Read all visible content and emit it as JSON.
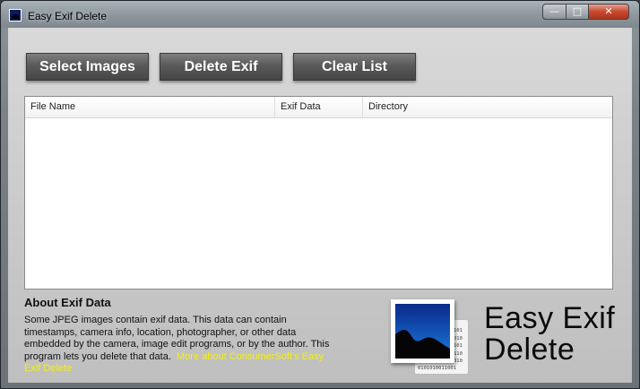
{
  "window": {
    "title": "Easy Exif Delete",
    "controls": {
      "minimize": "—",
      "maximize": "□",
      "close": "✕"
    }
  },
  "toolbar": {
    "select_images": "Select Images",
    "delete_exif": "Delete Exif",
    "clear_list": "Clear List"
  },
  "file_list": {
    "columns": [
      "File Name",
      "Exif Data",
      "Directory"
    ],
    "rows": []
  },
  "about": {
    "title": "About Exif Data",
    "text": "Some JPEG images contain exif data. This data can contain timestamps, camera info, location, photographer, or other data embedded by the camera, image edit programs, or by the author. This program lets you delete that data.",
    "link": "More about ConsumerSoft's Easy Exif Delete"
  },
  "branding": {
    "line1": "Easy Exif",
    "line2": "Delete",
    "binary_column": [
      "101",
      "010",
      "101",
      "110",
      "010"
    ],
    "binary_row": "0101010011001"
  },
  "colors": {
    "link": "#f2ef1a",
    "button": "#5a5a5a",
    "close_button": "#c8492f",
    "logo_sky": "#1560c8"
  }
}
